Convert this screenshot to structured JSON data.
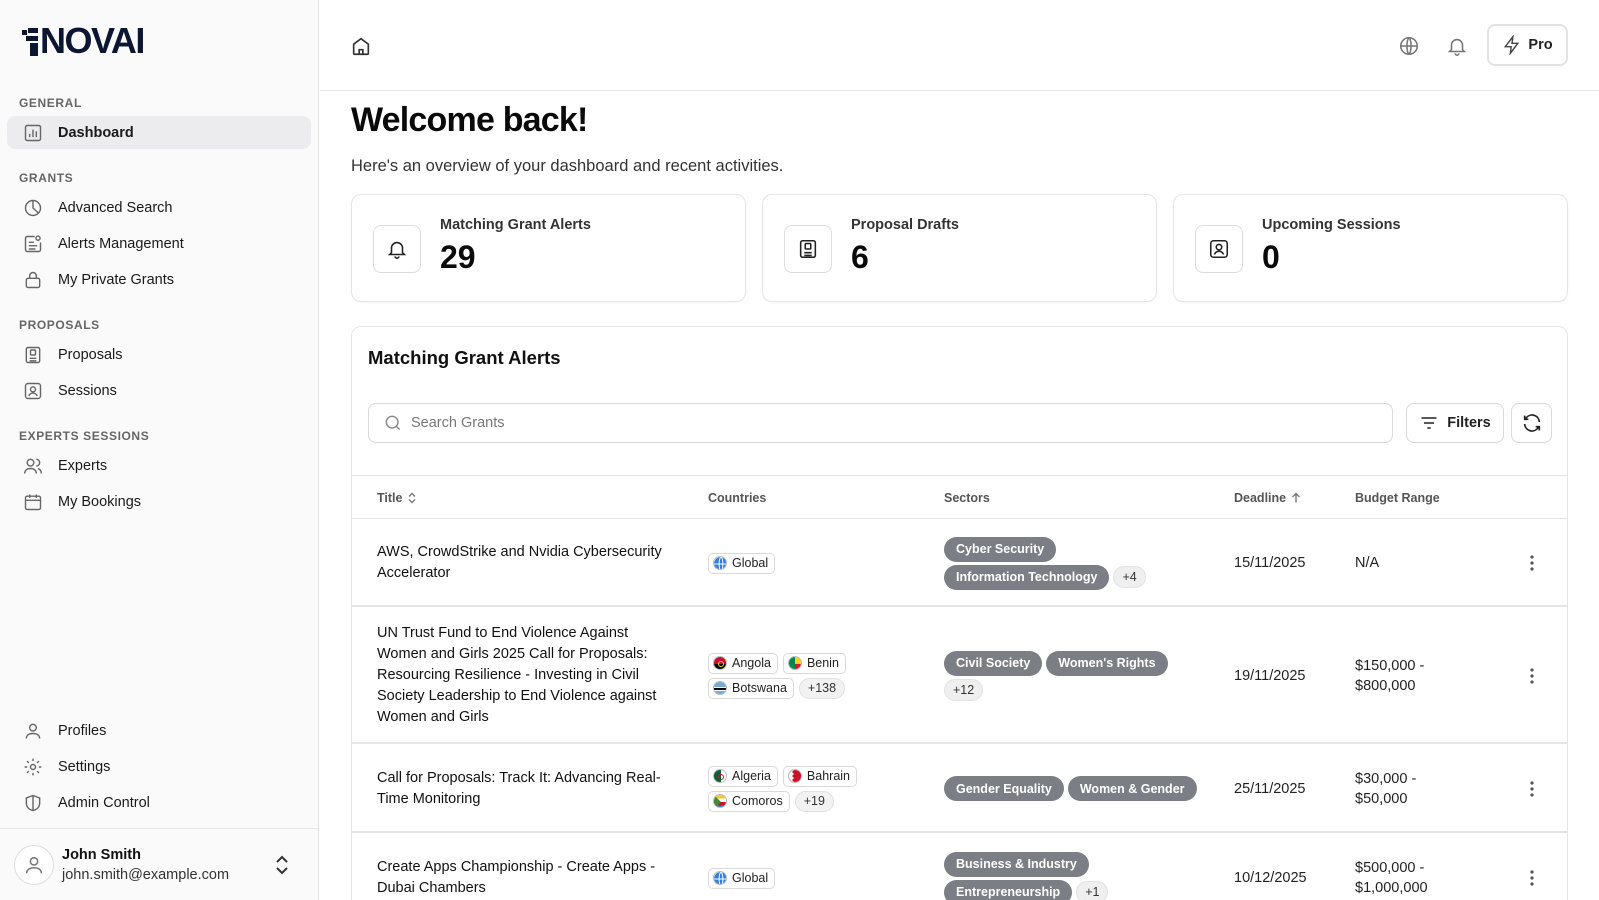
{
  "brand": {
    "name": "NOVAI"
  },
  "sidebar": {
    "sections": [
      {
        "label": "GENERAL",
        "items": [
          {
            "label": "Dashboard",
            "icon": "chart-bar-icon",
            "active": true
          }
        ]
      },
      {
        "label": "GRANTS",
        "items": [
          {
            "label": "Advanced Search",
            "icon": "pie-chart-icon"
          },
          {
            "label": "Alerts Management",
            "icon": "alert-list-icon"
          },
          {
            "label": "My Private Grants",
            "icon": "lock-icon"
          }
        ]
      },
      {
        "label": "PROPOSALS",
        "items": [
          {
            "label": "Proposals",
            "icon": "document-icon"
          },
          {
            "label": "Sessions",
            "icon": "user-square-icon"
          }
        ]
      },
      {
        "label": "EXPERTS SESSIONS",
        "items": [
          {
            "label": "Experts",
            "icon": "users-icon"
          },
          {
            "label": "My Bookings",
            "icon": "calendar-icon"
          }
        ]
      }
    ],
    "bottom_items": [
      {
        "label": "Profiles",
        "icon": "user-icon"
      },
      {
        "label": "Settings",
        "icon": "gear-icon"
      },
      {
        "label": "Admin Control",
        "icon": "shield-icon"
      }
    ],
    "user": {
      "name": "John Smith",
      "email": "john.smith@example.com"
    }
  },
  "topbar": {
    "pro_label": "Pro"
  },
  "main": {
    "welcome": "Welcome back!",
    "subtitle": "Here's an overview of your dashboard and recent activities.",
    "stats": [
      {
        "label": "Matching Grant Alerts",
        "value": "29",
        "icon": "bell-icon"
      },
      {
        "label": "Proposal Drafts",
        "value": "6",
        "icon": "document-icon"
      },
      {
        "label": "Upcoming Sessions",
        "value": "0",
        "icon": "user-square-icon"
      }
    ],
    "alerts": {
      "title": "Matching Grant Alerts",
      "search_placeholder": "Search Grants",
      "filters_label": "Filters",
      "columns": {
        "title": "Title",
        "countries": "Countries",
        "sectors": "Sectors",
        "deadline": "Deadline",
        "budget": "Budget Range"
      },
      "rows": [
        {
          "title": "AWS, CrowdStrike and Nvidia Cybersecurity Accelerator",
          "countries": [
            {
              "name": "Global",
              "flag": "globe"
            }
          ],
          "countries_more": "",
          "sectors": [
            "Cyber Security",
            "Information Technology"
          ],
          "sectors_more": "+4",
          "deadline": "15/11/2025",
          "budget": "N/A"
        },
        {
          "title": "UN Trust Fund to End Violence Against Women and Girls 2025 Call for Proposals: Resourcing Resilience - Investing in Civil Society Leadership to End Violence against Women and Girls",
          "countries": [
            {
              "name": "Angola",
              "flag": "angola"
            },
            {
              "name": "Benin",
              "flag": "benin"
            },
            {
              "name": "Botswana",
              "flag": "botswana"
            }
          ],
          "countries_more": "+138",
          "sectors": [
            "Civil Society",
            "Women's Rights"
          ],
          "sectors_more": "+12",
          "deadline": "19/11/2025",
          "budget": "$150,000 - $800,000"
        },
        {
          "title": "Call for Proposals: Track It: Advancing Real-Time Monitoring",
          "countries": [
            {
              "name": "Algeria",
              "flag": "algeria"
            },
            {
              "name": "Bahrain",
              "flag": "bahrain"
            },
            {
              "name": "Comoros",
              "flag": "comoros"
            }
          ],
          "countries_more": "+19",
          "sectors": [
            "Gender Equality",
            "Women & Gender"
          ],
          "sectors_more": "",
          "deadline": "25/11/2025",
          "budget": "$30,000 - $50,000"
        },
        {
          "title": "Create Apps Championship - Create Apps - Dubai Chambers",
          "countries": [
            {
              "name": "Global",
              "flag": "globe"
            }
          ],
          "countries_more": "",
          "sectors": [
            "Business & Industry",
            "Entrepreneurship"
          ],
          "sectors_more": "+1",
          "deadline": "10/12/2025",
          "budget": "$500,000 - $1,000,000"
        }
      ]
    }
  }
}
